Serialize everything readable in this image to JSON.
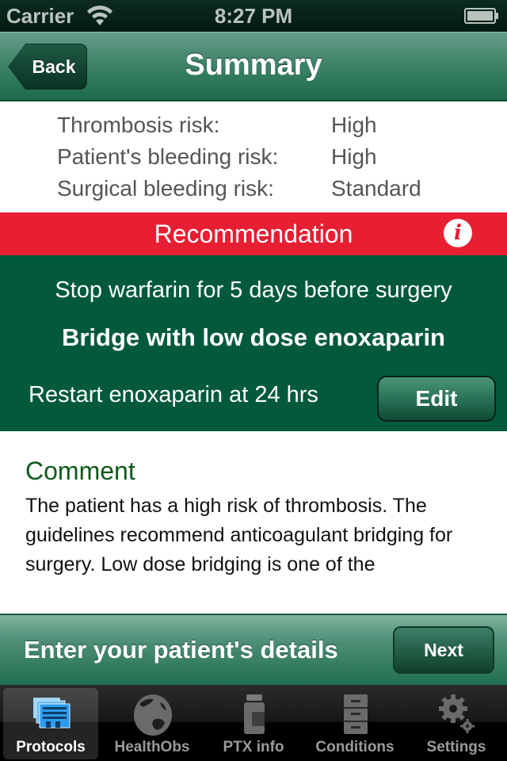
{
  "status_bar": {
    "carrier": "Carrier",
    "time": "8:27 PM",
    "wifi_icon": "wifi-icon",
    "battery_icon": "battery-full-icon"
  },
  "nav": {
    "back_label": "Back",
    "title": "Summary"
  },
  "risks": [
    {
      "label": "Thrombosis risk:",
      "value": "High"
    },
    {
      "label": "Patient's bleeding risk:",
      "value": "High"
    },
    {
      "label": "Surgical bleeding risk:",
      "value": "Standard"
    }
  ],
  "recommendation": {
    "header": "Recommendation",
    "info_icon": "info-icon",
    "line1": "Stop warfarin for 5 days before surgery",
    "line2": "Bridge with low dose enoxaparin",
    "line3": "Restart enoxaparin at 24 hrs",
    "edit_label": "Edit"
  },
  "comment": {
    "title": "Comment",
    "text": "The patient has a high risk of thrombosis. The guidelines recommend anticoagulant bridging for surgery. Low dose bridging is one of the"
  },
  "action_bar": {
    "label": "Enter your patient's details",
    "next_label": "Next"
  },
  "tabs": [
    {
      "label": "Protocols",
      "icon": "protocols-icon",
      "active": true
    },
    {
      "label": "HealthObs",
      "icon": "globe-icon",
      "active": false
    },
    {
      "label": "PTX info",
      "icon": "medicine-bottle-icon",
      "active": false
    },
    {
      "label": "Conditions",
      "icon": "filing-cabinet-icon",
      "active": false
    },
    {
      "label": "Settings",
      "icon": "gears-icon",
      "active": false
    }
  ],
  "colors": {
    "nav_green": "#3f8469",
    "recommendation_red": "#e81e33",
    "recommendation_green": "#035a3b",
    "comment_title_green": "#0f5a1c",
    "active_tab_blue": "#3aa0ef"
  }
}
